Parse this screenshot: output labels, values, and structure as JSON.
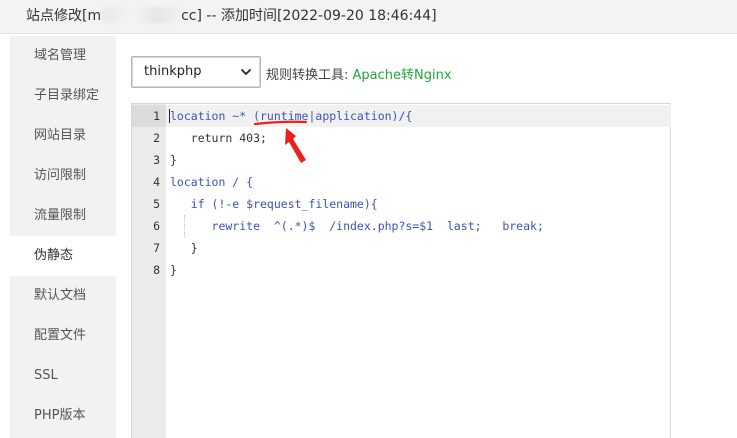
{
  "window": {
    "title_prefix": "站点修改[m",
    "title_suffix": "cc] -- 添加时间[2022-09-20 18:46:44]"
  },
  "sidebar": {
    "items": [
      {
        "label": "域名管理"
      },
      {
        "label": "子目录绑定"
      },
      {
        "label": "网站目录"
      },
      {
        "label": "访问限制"
      },
      {
        "label": "流量限制"
      },
      {
        "label": "伪静态",
        "active": true
      },
      {
        "label": "默认文档"
      },
      {
        "label": "配置文件"
      },
      {
        "label": "SSL"
      },
      {
        "label": "PHP版本"
      }
    ]
  },
  "rewrite": {
    "template_select": "thinkphp",
    "tool_label": "规则转换工具:",
    "tool_link": "Apache转Nginx"
  },
  "editor": {
    "line_numbers": [
      "1",
      "2",
      "3",
      "4",
      "5",
      "6",
      "7",
      "8"
    ],
    "lines": [
      "location ~* (runtime|application)/{",
      "   return 403;",
      "}",
      "location / {",
      "   if (!-e $request_filename){",
      "      rewrite  ^(.*)$  /index.php?s=$1  last;   break;",
      "   }",
      "}"
    ]
  },
  "colors": {
    "accent_green": "#20a53a",
    "annotation_red": "#e8221a",
    "keyword_blue": "#3f51b5"
  }
}
